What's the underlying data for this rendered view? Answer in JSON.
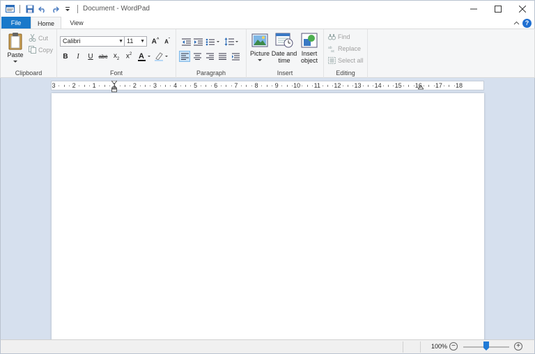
{
  "window": {
    "title": "Document - WordPad"
  },
  "quick_access": {
    "save_icon": "save-icon",
    "undo_icon": "undo-icon",
    "redo_icon": "redo-icon"
  },
  "tabs": {
    "file": "File",
    "home": "Home",
    "view": "View"
  },
  "clipboard": {
    "paste": "Paste",
    "cut": "Cut",
    "copy": "Copy",
    "group": "Clipboard"
  },
  "font": {
    "family": "Calibri",
    "size": "11",
    "group": "Font"
  },
  "paragraph": {
    "group": "Paragraph"
  },
  "insert": {
    "picture": "Picture",
    "datetime_1": "Date and",
    "datetime_2": "time",
    "object_1": "Insert",
    "object_2": "object",
    "group": "Insert"
  },
  "editing": {
    "find": "Find",
    "replace": "Replace",
    "select_all": "Select all",
    "group": "Editing"
  },
  "ruler": {
    "labels": [
      "3",
      "2",
      "1",
      "1",
      "2",
      "3",
      "4",
      "5",
      "6",
      "7",
      "8",
      "9",
      "10",
      "11",
      "12",
      "13",
      "14",
      "15",
      "16",
      "17",
      "18"
    ]
  },
  "status": {
    "zoom": "100%"
  },
  "colors": {
    "accent": "#1979ca",
    "workspace": "#d6e0ee",
    "font_color": "#000000",
    "highlight": "#b6d7f5"
  }
}
